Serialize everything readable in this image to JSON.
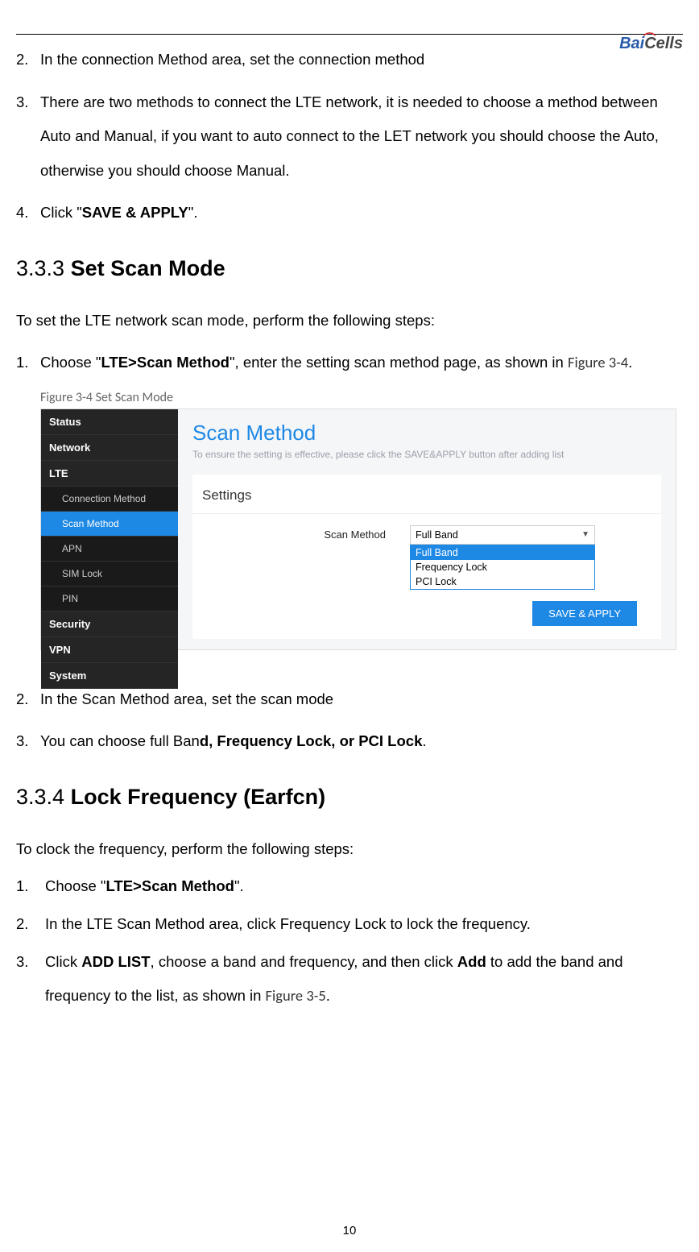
{
  "logo": {
    "part1": "Bai",
    "part2": "Cells"
  },
  "intro_list": {
    "i2": {
      "n": "2.",
      "t": "In the connection Method area, set the connection method"
    },
    "i3": {
      "n": "3.",
      "t1": "There are two methods to connect the LTE network, it is needed to choose a method between Auto and Manual, if you want to auto connect to the LET network you should choose the Auto, otherwise you should choose Manual."
    },
    "i4": {
      "n": "4.",
      "t_pre": "Click \"",
      "bold": "SAVE & APPLY",
      "t_post": "\"."
    }
  },
  "sec333": {
    "num": "3.3.3",
    "title": "Set Scan Mode",
    "para": "To set the LTE network scan mode, perform the following steps:",
    "s1": {
      "n": "1.",
      "pre": "Choose \"",
      "bold": "LTE>Scan Method",
      "mid": "\", enter the setting scan method page, as shown in ",
      "figref": "Figure 3-4",
      "post": "."
    },
    "figcap": "Figure 3-4 Set Scan Mode",
    "s2": {
      "n": "2.",
      "t": "In the Scan Method area, set the scan mode"
    },
    "s3": {
      "n": "3.",
      "pre": "You can choose full Ban",
      "bold": "d, Frequency Lock, or PCI Lock",
      "post": "."
    }
  },
  "shot": {
    "sidebar": {
      "status": "Status",
      "network": "Network",
      "lte": "LTE",
      "conn": "Connection Method",
      "scan": "Scan Method",
      "apn": "APN",
      "sim": "SIM Lock",
      "pin": "PIN",
      "security": "Security",
      "vpn": "VPN",
      "system": "System"
    },
    "title": "Scan Method",
    "hint": "To ensure the setting is effective, please click the SAVE&APPLY button after adding list",
    "settings": "Settings",
    "form_label": "Scan Method",
    "selected": "Full Band",
    "options": {
      "o1": "Full Band",
      "o2": "Frequency Lock",
      "o3": "PCI Lock"
    },
    "save": "SAVE & APPLY"
  },
  "sec334": {
    "num": "3.3.4",
    "title": "Lock Frequency (Earfcn)",
    "para": "To clock the frequency, perform the following steps:",
    "s1": {
      "n": "1.",
      "pre": "Choose \"",
      "bold": "LTE>Scan Method",
      "post": "\"."
    },
    "s2": {
      "n": "2.",
      "t": "In the LTE Scan Method area, click Frequency Lock to lock the frequency."
    },
    "s3": {
      "n": "3.",
      "pre": "Click ",
      "b1": "ADD LIST",
      "mid": ", choose a band and frequency, and then click ",
      "b2": "Add",
      "mid2": " to add the band and frequency to the list, as shown in ",
      "figref": "Figure 3-5",
      "post": "."
    }
  },
  "page": "10"
}
